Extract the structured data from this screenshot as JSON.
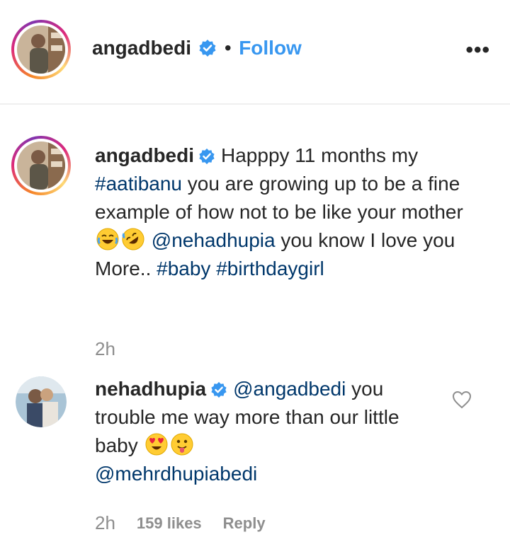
{
  "header": {
    "username": "angadbedi",
    "separator": "•",
    "follow_label": "Follow",
    "more_label": "•••"
  },
  "caption": {
    "username": "angadbedi",
    "text_1": "Happpy 11 months my ",
    "hashtag_1": "#aatibanu",
    "text_2": " you are growing up to be a fine example of how not to be like your mother ",
    "emoji_1": "joy-emoji",
    "emoji_2": "rofl-emoji",
    "mention_1": "@nehadhupia",
    "text_3": " you know I love you More.. ",
    "hashtag_2": "#baby",
    "hashtag_3": "#birthdaygirl",
    "time": "2h"
  },
  "comment": {
    "username": "nehadhupia",
    "mention_1": "@angadbedi",
    "text_1": " you trouble me way more than our little baby ",
    "emoji_1": "heart-eyes-emoji",
    "emoji_2": "tongue-out-emoji",
    "mention_2": "@mehrdhupiabedi",
    "time": "2h",
    "likes": "159 likes",
    "reply_label": "Reply"
  },
  "colors": {
    "link": "#00376b",
    "follow": "#3897f0",
    "verified": "#3897f0",
    "muted": "#8e8e8e"
  }
}
